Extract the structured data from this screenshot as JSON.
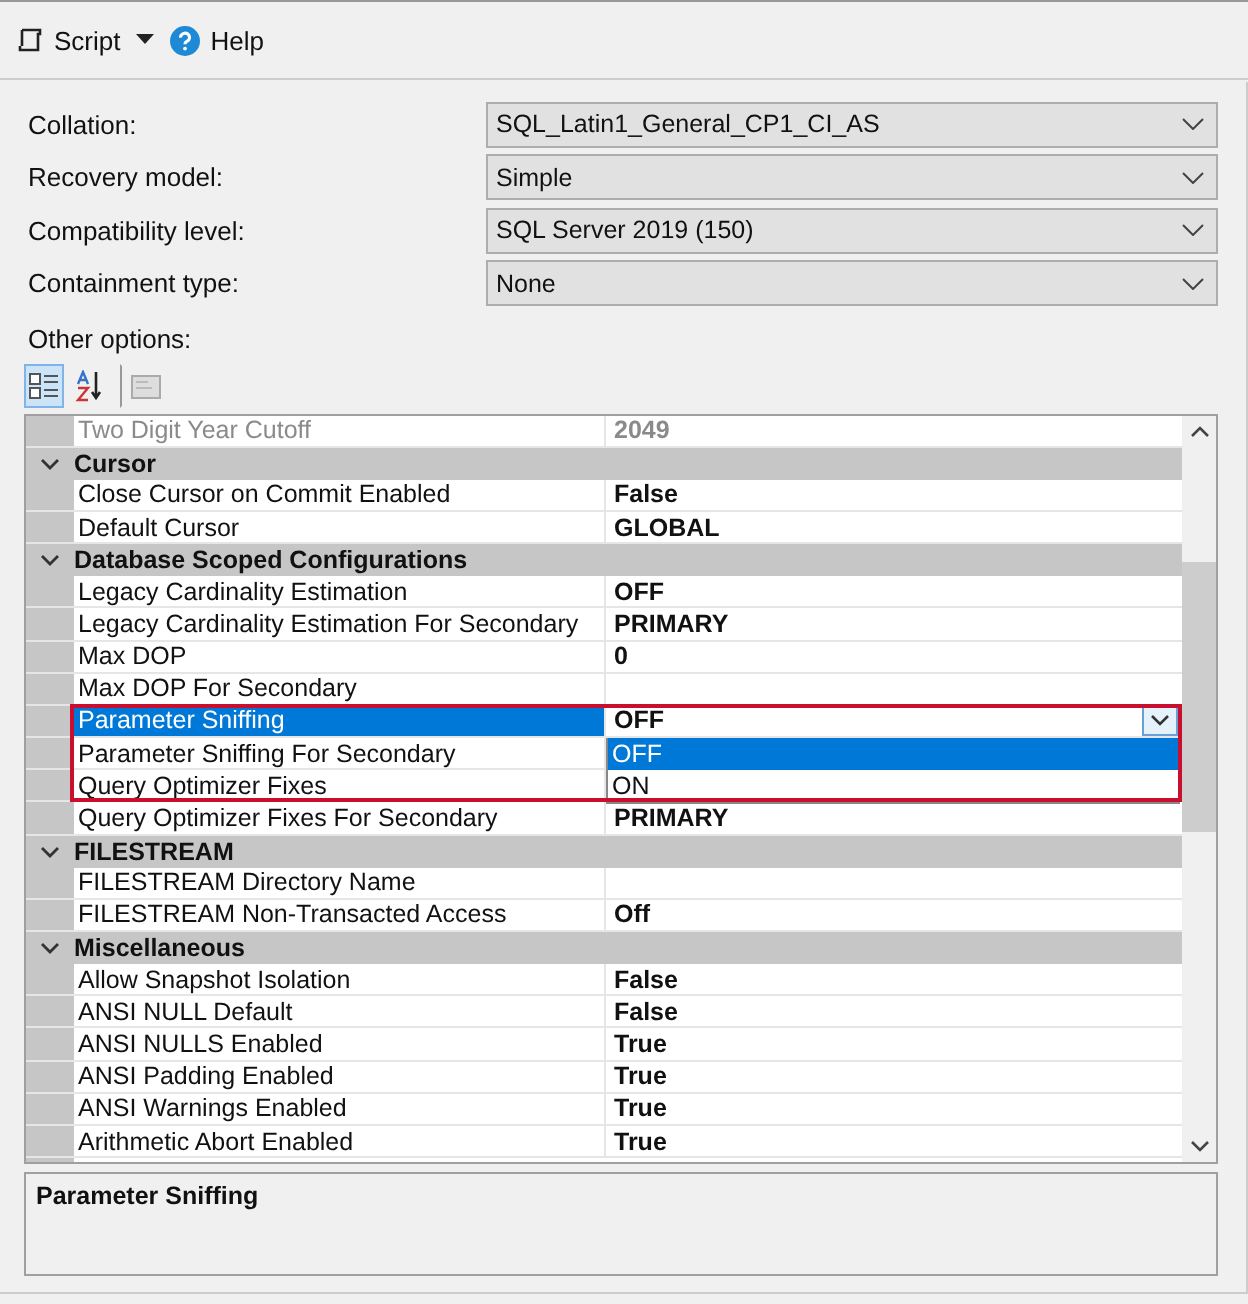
{
  "toolbar": {
    "script_label": "Script",
    "help_label": "Help"
  },
  "fields": [
    {
      "label": "Collation:",
      "value": "SQL_Latin1_General_CP1_CI_AS"
    },
    {
      "label": "Recovery model:",
      "value": "Simple"
    },
    {
      "label": "Compatibility level:",
      "value": "SQL Server 2019 (150)"
    },
    {
      "label": "Containment type:",
      "value": "None"
    }
  ],
  "other_options_label": "Other options:",
  "grid_toolbar": [
    {
      "kind": "categorized",
      "selected": true
    },
    {
      "kind": "alphabetical",
      "selected": false
    },
    {
      "kind": "pages",
      "selected": false
    }
  ],
  "rows": [
    {
      "kind": "property",
      "name": "Two Digit Year Cutoff",
      "value": "2049",
      "readonly": true,
      "selected": false
    },
    {
      "kind": "category",
      "name": "Cursor",
      "expanded": true
    },
    {
      "kind": "property",
      "name": "Close Cursor on Commit Enabled",
      "value": "False",
      "readonly": false,
      "selected": false
    },
    {
      "kind": "property",
      "name": "Default Cursor",
      "value": "GLOBAL",
      "readonly": false,
      "selected": false
    },
    {
      "kind": "category",
      "name": "Database Scoped Configurations",
      "expanded": true
    },
    {
      "kind": "property",
      "name": "Legacy Cardinality Estimation",
      "value": "OFF",
      "readonly": false,
      "selected": false
    },
    {
      "kind": "property",
      "name": "Legacy Cardinality Estimation For Secondary",
      "value": "PRIMARY",
      "readonly": false,
      "selected": false
    },
    {
      "kind": "property",
      "name": "Max DOP",
      "value": "0",
      "readonly": false,
      "selected": false
    },
    {
      "kind": "property",
      "name": "Max DOP For Secondary",
      "readonly": false,
      "selected": false
    },
    {
      "kind": "property",
      "name": "Parameter Sniffing",
      "value": "OFF",
      "readonly": false,
      "selected": true,
      "dropdown_open": true
    },
    {
      "kind": "property",
      "name": "Parameter Sniffing For Secondary",
      "readonly": false,
      "selected": false
    },
    {
      "kind": "property",
      "name": "Query Optimizer Fixes",
      "readonly": false,
      "selected": false
    },
    {
      "kind": "property",
      "name": "Query Optimizer Fixes For Secondary",
      "value": "PRIMARY",
      "readonly": false,
      "selected": false
    },
    {
      "kind": "category",
      "name": "FILESTREAM",
      "expanded": true
    },
    {
      "kind": "property",
      "name": "FILESTREAM Directory Name",
      "readonly": false,
      "selected": false
    },
    {
      "kind": "property",
      "name": "FILESTREAM Non-Transacted Access",
      "value": "Off",
      "readonly": false,
      "selected": false
    },
    {
      "kind": "category",
      "name": "Miscellaneous",
      "expanded": true
    },
    {
      "kind": "property",
      "name": "Allow Snapshot Isolation",
      "value": "False",
      "readonly": false,
      "selected": false
    },
    {
      "kind": "property",
      "name": "ANSI NULL Default",
      "value": "False",
      "readonly": false,
      "selected": false
    },
    {
      "kind": "property",
      "name": "ANSI NULLS Enabled",
      "value": "True",
      "readonly": false,
      "selected": false
    },
    {
      "kind": "property",
      "name": "ANSI Padding Enabled",
      "value": "True",
      "readonly": false,
      "selected": false
    },
    {
      "kind": "property",
      "name": "ANSI Warnings Enabled",
      "value": "True",
      "readonly": false,
      "selected": false
    },
    {
      "kind": "property",
      "name": "Arithmetic Abort Enabled",
      "value": "True",
      "readonly": false,
      "selected": false
    }
  ],
  "dropdown_options": [
    {
      "label": "OFF",
      "selected": true
    },
    {
      "label": "ON",
      "selected": false
    }
  ],
  "description": {
    "title": "Parameter Sniffing"
  }
}
